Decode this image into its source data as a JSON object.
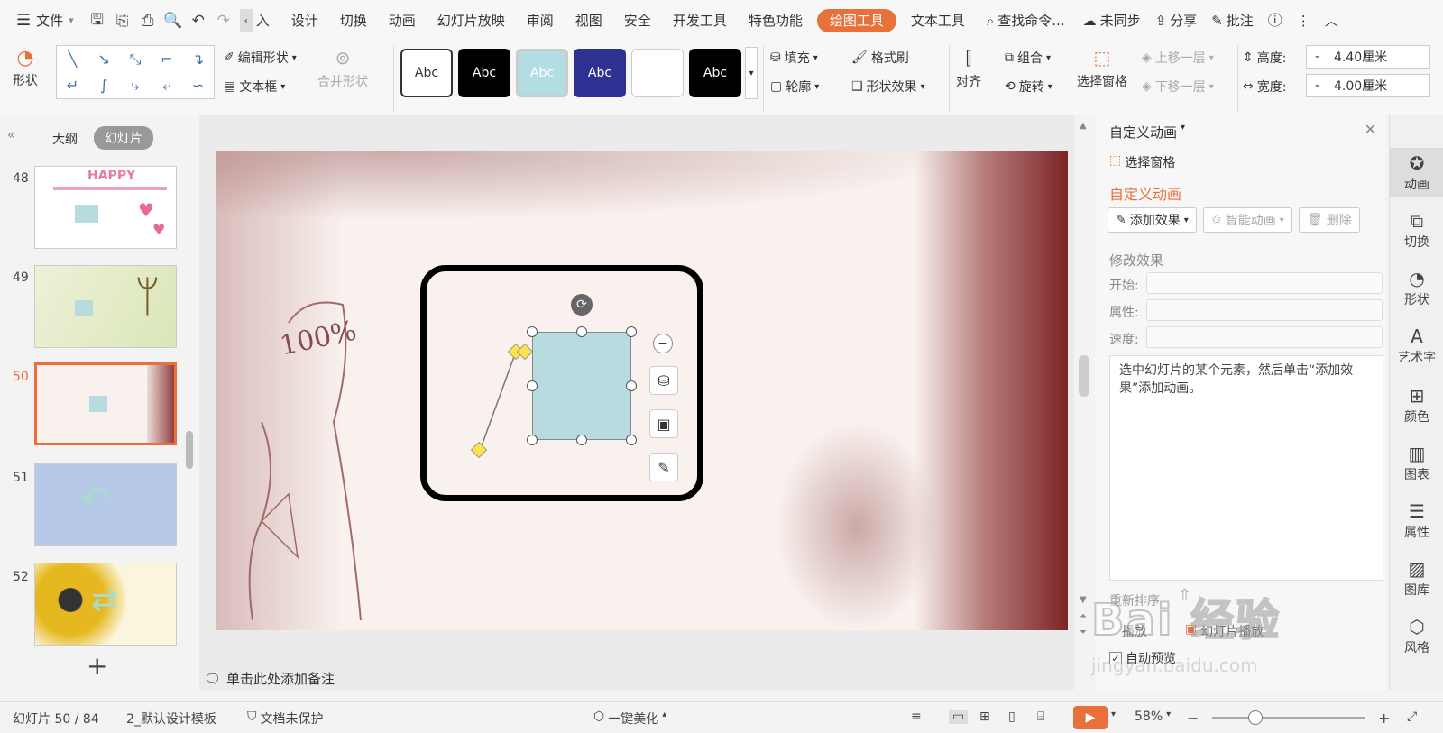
{
  "menu": {
    "file_label": "文件",
    "tabs": [
      "入",
      "设计",
      "切换",
      "动画",
      "幻灯片放映",
      "审阅",
      "视图",
      "安全",
      "开发工具",
      "特色功能",
      "绘图工具",
      "文本工具"
    ],
    "search_placeholder": "查找命令...",
    "sync_label": "未同步",
    "share_label": "分享",
    "comment_label": "批注"
  },
  "ribbon": {
    "shape_label": "形状",
    "edit_shape_label": "编辑形状",
    "textbox_label": "文本框",
    "merge_shape_label": "合并形状",
    "style_sample": "Abc",
    "fill_label": "填充",
    "format_painter_label": "格式刷",
    "outline_label": "轮廓",
    "shape_effect_label": "形状效果",
    "align_label": "对齐",
    "group_label": "组合",
    "rotate_label": "旋转",
    "selection_pane_label": "选择窗格",
    "move_up_label": "上移一层",
    "move_down_label": "下移一层",
    "height_label": "高度:",
    "height_value": "4.40厘米",
    "width_label": "宽度:",
    "width_value": "4.00厘米",
    "minus": "-"
  },
  "left_panel": {
    "tab_outline": "大纲",
    "tab_slides": "幻灯片",
    "slides": [
      {
        "num": "48"
      },
      {
        "num": "49"
      },
      {
        "num": "50"
      },
      {
        "num": "51"
      },
      {
        "num": "52"
      }
    ],
    "add_glyph": "+",
    "happy_text": "HAPPY"
  },
  "slide": {
    "sketch_text": "100%"
  },
  "notes": {
    "placeholder": "单击此处添加备注"
  },
  "right_panel": {
    "header": "自定义动画",
    "selection_pane": "选择窗格",
    "section_title": "自定义动画",
    "add_effect": "添加效果",
    "smart_anim": "智能动画",
    "delete": "删除",
    "modify_title": "修改效果",
    "start_label": "开始:",
    "property_label": "属性:",
    "speed_label": "速度:",
    "hint": "选中幻灯片的某个元素，然后单击“添加效果”添加动画。",
    "reorder_label": "重新排序",
    "play_label": "播放",
    "slideshow_label": "幻灯片播放",
    "auto_preview": "自动预览"
  },
  "right_side": {
    "items": [
      "动画",
      "切换",
      "形状",
      "艺术字",
      "颜色",
      "图表",
      "属性",
      "图库",
      "风格"
    ]
  },
  "status": {
    "slide_pos": "幻灯片 50 / 84",
    "template": "2_默认设计模板",
    "protect": "文档未保护",
    "beautify": "一键美化",
    "zoom": "58%"
  },
  "watermark": {
    "text": "Bai 经验",
    "url": "jingyan.baidu.com"
  },
  "colors": {
    "accent": "#e8703a",
    "shape_fill": "#b6dce0",
    "style_teal": "#b2dde2",
    "style_navy": "#2e3192"
  }
}
